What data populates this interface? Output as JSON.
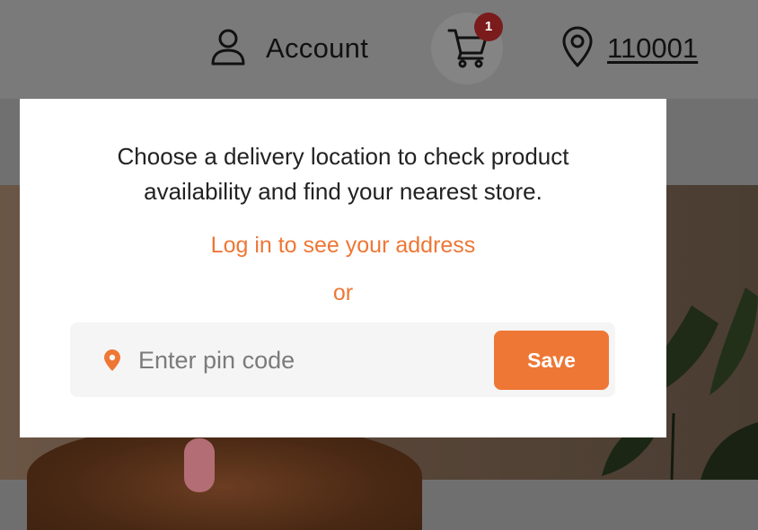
{
  "header": {
    "account_label": "Account",
    "cart_count": "1",
    "pincode": "110001"
  },
  "modal": {
    "message_line1": "Choose a delivery location to check product",
    "message_line2": "availability and find your nearest store.",
    "login_link": "Log in to see your address",
    "or_text": "or",
    "pin_placeholder": "Enter pin code",
    "pin_value": "",
    "save_label": "Save"
  },
  "colors": {
    "accent": "#ee7735",
    "badge": "#7a1c1c",
    "overlay": "#7a7a7a"
  },
  "icons": [
    "user-icon",
    "cart-icon",
    "map-pin-icon",
    "location-pin-icon"
  ]
}
